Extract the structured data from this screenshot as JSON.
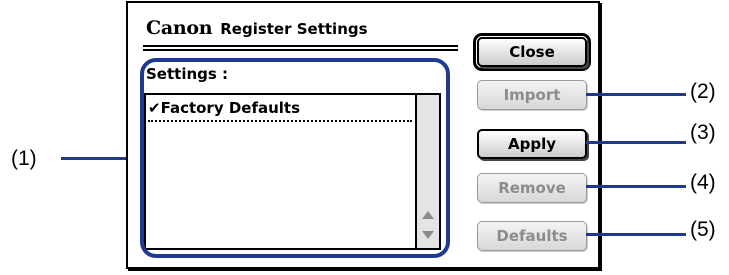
{
  "dialog": {
    "brand": "Canon",
    "title": "Register Settings",
    "settings_label": "Settings :",
    "list_items": [
      {
        "check": "✔",
        "label": "Factory Defaults"
      }
    ]
  },
  "buttons": {
    "close": "Close",
    "import": "Import",
    "apply": "Apply",
    "remove": "Remove",
    "defaults": "Defaults"
  },
  "callouts": {
    "c1": "(1)",
    "c2": "(2)",
    "c3": "(3)",
    "c4": "(4)",
    "c5": "(5)"
  },
  "colors": {
    "callout_line": "#1f3a93",
    "disabled_text": "#8c8c8c"
  },
  "icons": {
    "scroll_up": "scroll-up-arrow-icon",
    "scroll_down": "scroll-down-arrow-icon"
  }
}
